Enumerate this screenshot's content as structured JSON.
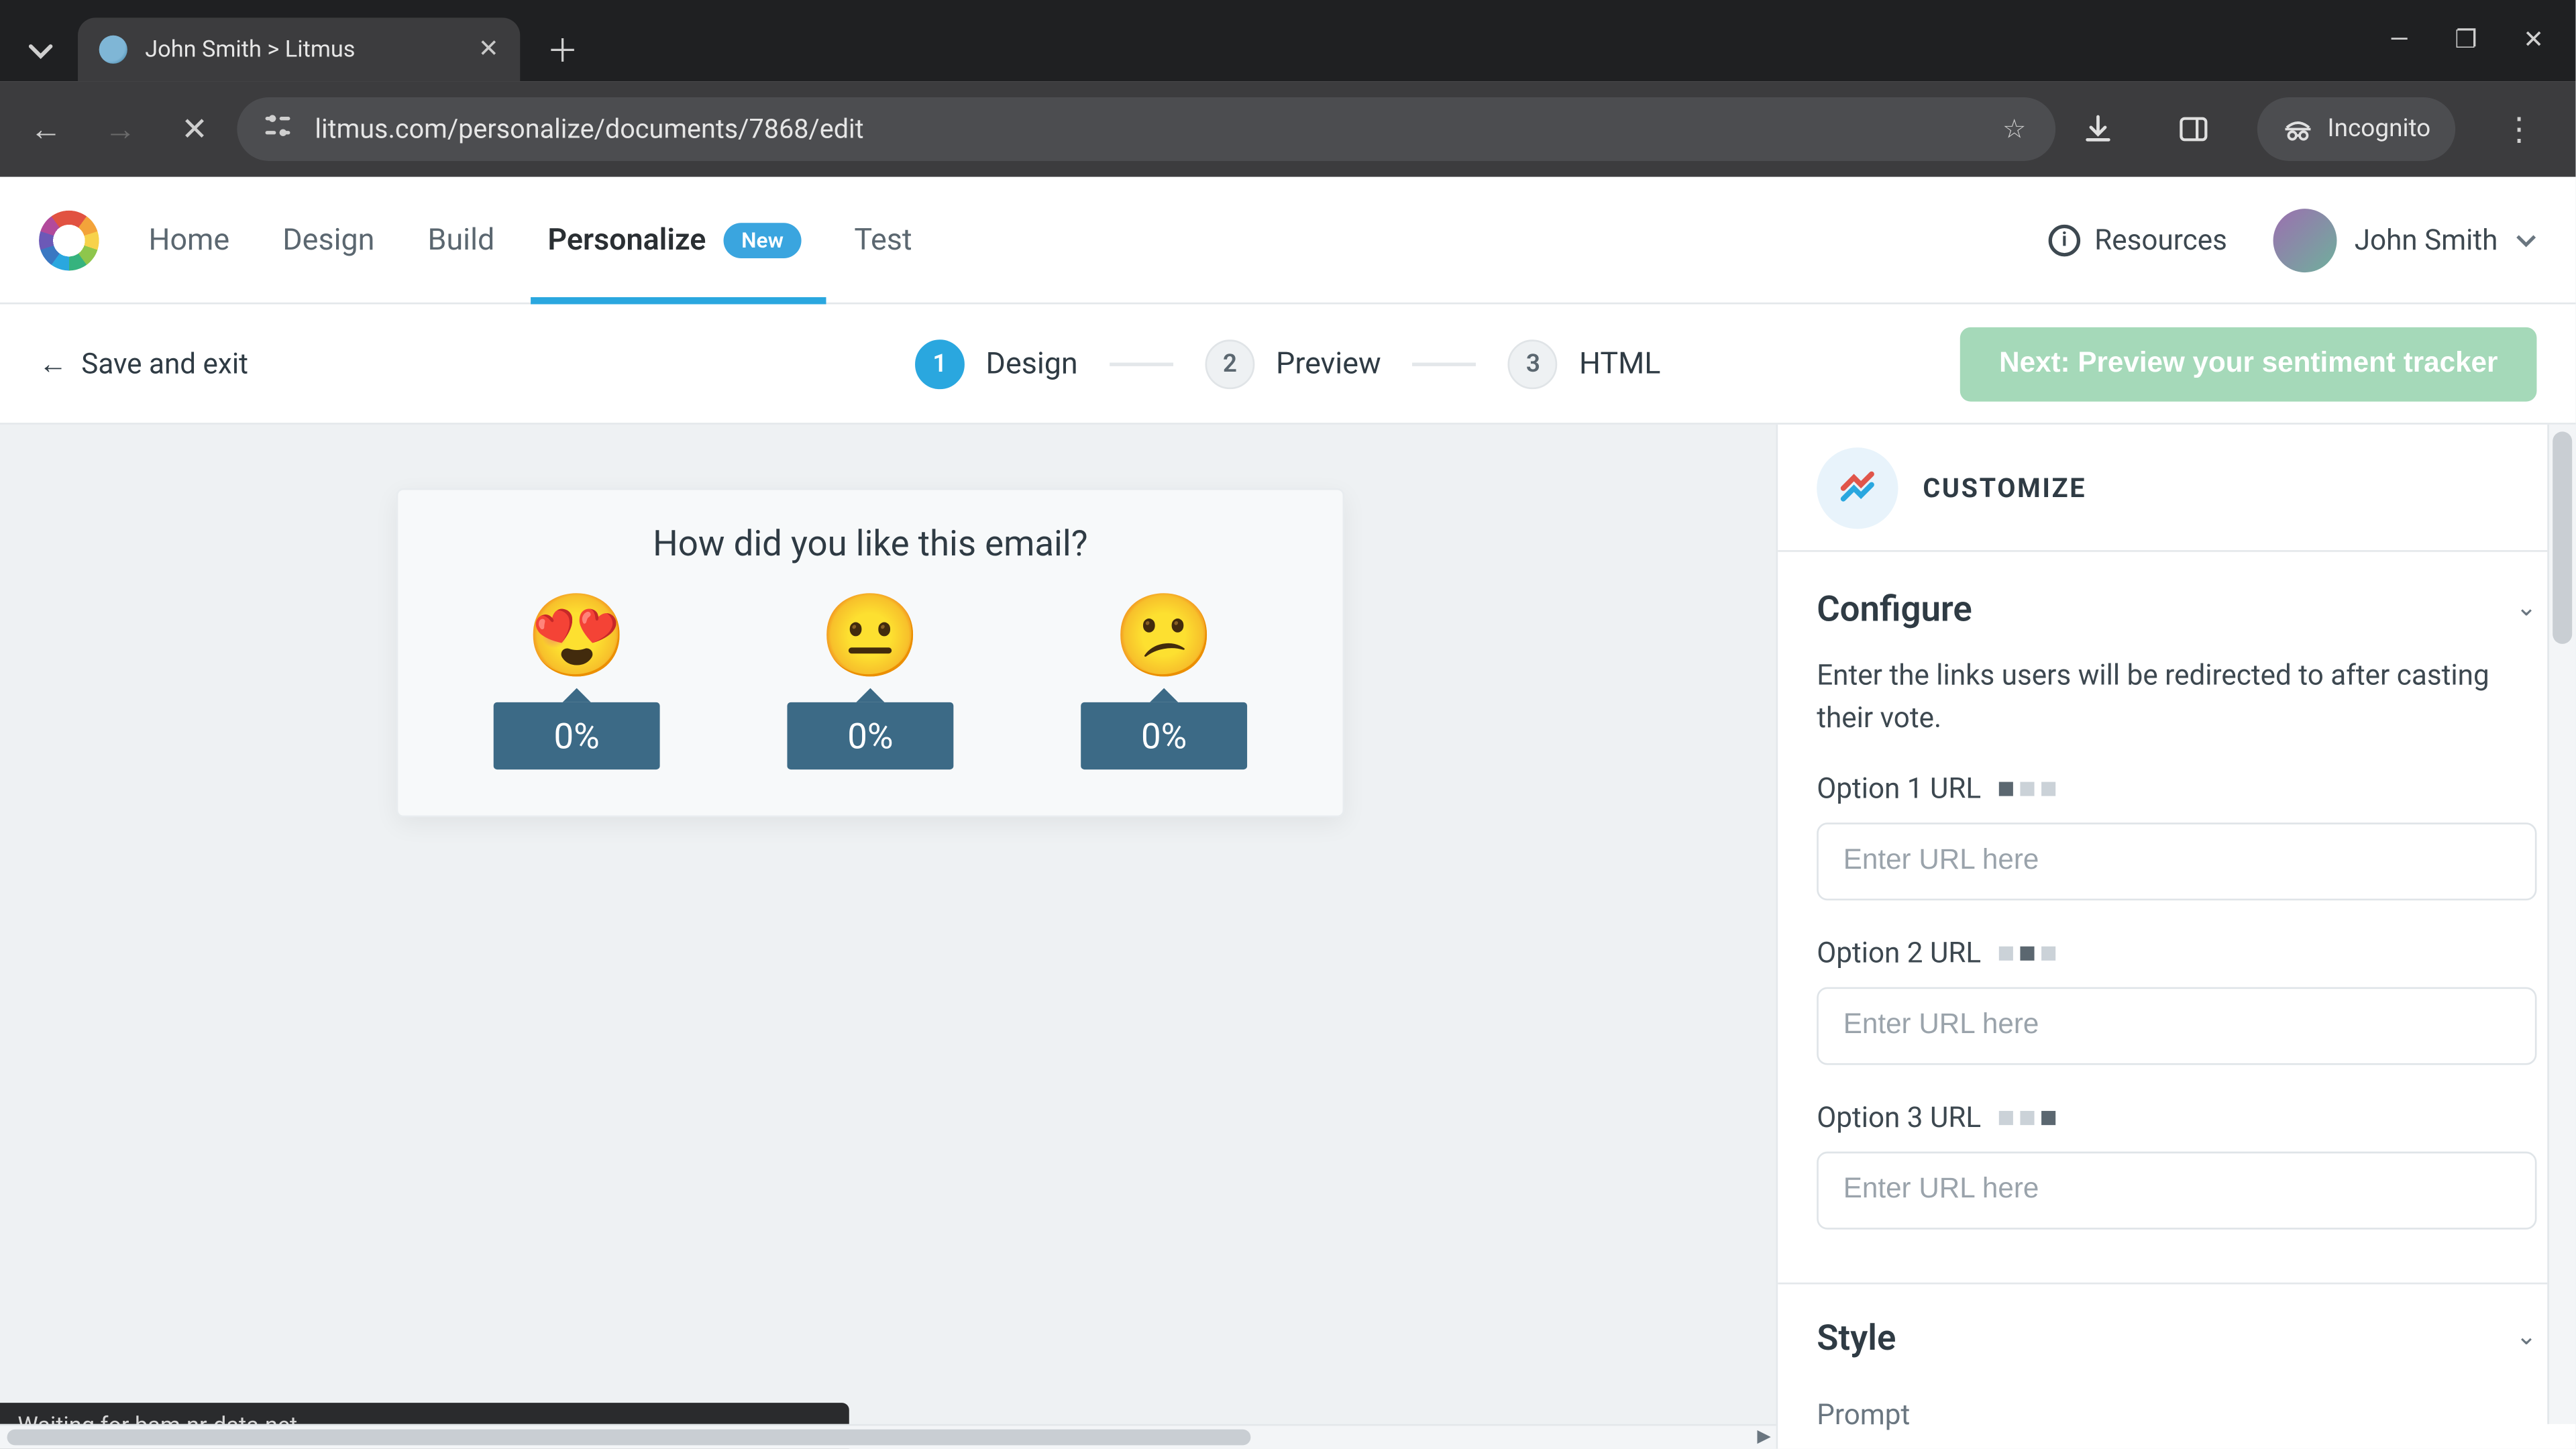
{
  "browser": {
    "tab_title": "John Smith > Litmus",
    "url": "litmus.com/personalize/documents/7868/edit",
    "incognito_label": "Incognito",
    "status_text": "Waiting for bam.nr-data.net..."
  },
  "nav": {
    "items": [
      "Home",
      "Design",
      "Build",
      "Personalize",
      "Test"
    ],
    "active_index": 3,
    "badge_new": "New",
    "resources_label": "Resources",
    "user_name": "John Smith"
  },
  "subbar": {
    "save_exit": "Save and exit",
    "steps": [
      {
        "num": "1",
        "label": "Design"
      },
      {
        "num": "2",
        "label": "Preview"
      },
      {
        "num": "3",
        "label": "HTML"
      }
    ],
    "active_step": 0,
    "cta": "Next: Preview your sentiment tracker"
  },
  "card": {
    "title": "How did you like this email?",
    "options": [
      {
        "emoji": "😍",
        "percent": "0%"
      },
      {
        "emoji": "😐",
        "percent": "0%"
      },
      {
        "emoji": "😕",
        "percent": "0%"
      }
    ]
  },
  "panel": {
    "customize_label": "CUSTOMIZE",
    "configure": {
      "title": "Configure",
      "desc": "Enter the links users will be redirected to after casting their vote.",
      "fields": [
        {
          "label": "Option 1 URL",
          "placeholder": "Enter URL here",
          "active_dot": 0
        },
        {
          "label": "Option 2 URL",
          "placeholder": "Enter URL here",
          "active_dot": 1
        },
        {
          "label": "Option 3 URL",
          "placeholder": "Enter URL here",
          "active_dot": 2
        }
      ]
    },
    "style": {
      "title": "Style"
    },
    "prompt_label": "Prompt"
  }
}
